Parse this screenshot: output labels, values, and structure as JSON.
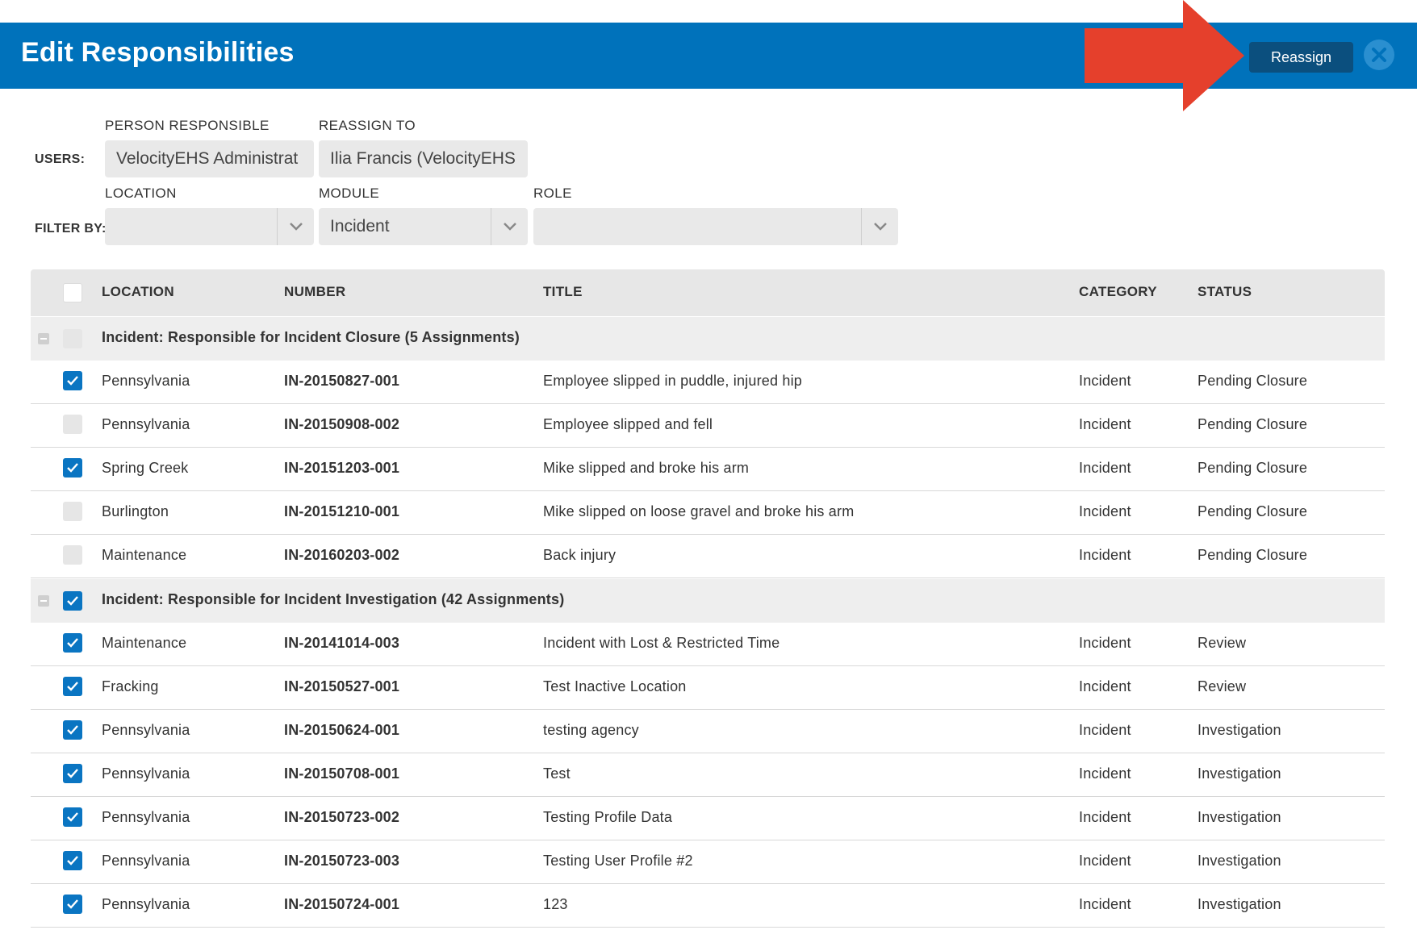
{
  "header": {
    "title": "Edit Responsibilities",
    "reassign_label": "Reassign",
    "close_icon": "close-circle-icon",
    "accent": "#0072bb"
  },
  "annotation": {
    "arrow_color": "#e5402c"
  },
  "form": {
    "users_label": "USERS:",
    "filter_label": "FILTER BY:",
    "person_responsible_label": "PERSON RESPONSIBLE",
    "person_responsible_value": "VelocityEHS Administrat",
    "reassign_to_label": "REASSIGN TO",
    "reassign_to_value": "Ilia Francis (VelocityEHS",
    "location_label": "LOCATION",
    "location_value": "",
    "module_label": "MODULE",
    "module_value": "Incident",
    "role_label": "ROLE",
    "role_value": ""
  },
  "table": {
    "headers": [
      "LOCATION",
      "NUMBER",
      "TITLE",
      "CATEGORY",
      "STATUS"
    ],
    "groups": [
      {
        "label": "Incident: Responsible for Incident Closure (5 Assignments)",
        "checked": false,
        "rows": [
          {
            "checked": true,
            "location": "Pennsylvania",
            "number": "IN-20150827-001",
            "title": "Employee slipped in puddle, injured hip",
            "category": "Incident",
            "status": "Pending Closure"
          },
          {
            "checked": false,
            "location": "Pennsylvania",
            "number": "IN-20150908-002",
            "title": "Employee slipped and fell",
            "category": "Incident",
            "status": "Pending Closure"
          },
          {
            "checked": true,
            "location": "Spring Creek",
            "number": "IN-20151203-001",
            "title": "Mike slipped and broke his arm",
            "category": "Incident",
            "status": "Pending Closure"
          },
          {
            "checked": false,
            "location": "Burlington",
            "number": "IN-20151210-001",
            "title": "Mike slipped on loose gravel and broke his arm",
            "category": "Incident",
            "status": "Pending Closure"
          },
          {
            "checked": false,
            "location": "Maintenance",
            "number": "IN-20160203-002",
            "title": "Back injury",
            "category": "Incident",
            "status": "Pending Closure"
          }
        ]
      },
      {
        "label": "Incident: Responsible for Incident Investigation (42 Assignments)",
        "checked": true,
        "rows": [
          {
            "checked": true,
            "location": "Maintenance",
            "number": "IN-20141014-003",
            "title": "Incident with Lost & Restricted Time",
            "category": "Incident",
            "status": "Review"
          },
          {
            "checked": true,
            "location": "Fracking",
            "number": "IN-20150527-001",
            "title": "Test Inactive Location",
            "category": "Incident",
            "status": "Review"
          },
          {
            "checked": true,
            "location": "Pennsylvania",
            "number": "IN-20150624-001",
            "title": "testing agency",
            "category": "Incident",
            "status": "Investigation"
          },
          {
            "checked": true,
            "location": "Pennsylvania",
            "number": "IN-20150708-001",
            "title": "Test",
            "category": "Incident",
            "status": "Investigation"
          },
          {
            "checked": true,
            "location": "Pennsylvania",
            "number": "IN-20150723-002",
            "title": "Testing Profile Data",
            "category": "Incident",
            "status": "Investigation"
          },
          {
            "checked": true,
            "location": "Pennsylvania",
            "number": "IN-20150723-003",
            "title": "Testing User Profile #2",
            "category": "Incident",
            "status": "Investigation"
          },
          {
            "checked": true,
            "location": "Pennsylvania",
            "number": "IN-20150724-001",
            "title": "123",
            "category": "Incident",
            "status": "Investigation"
          }
        ]
      }
    ]
  }
}
